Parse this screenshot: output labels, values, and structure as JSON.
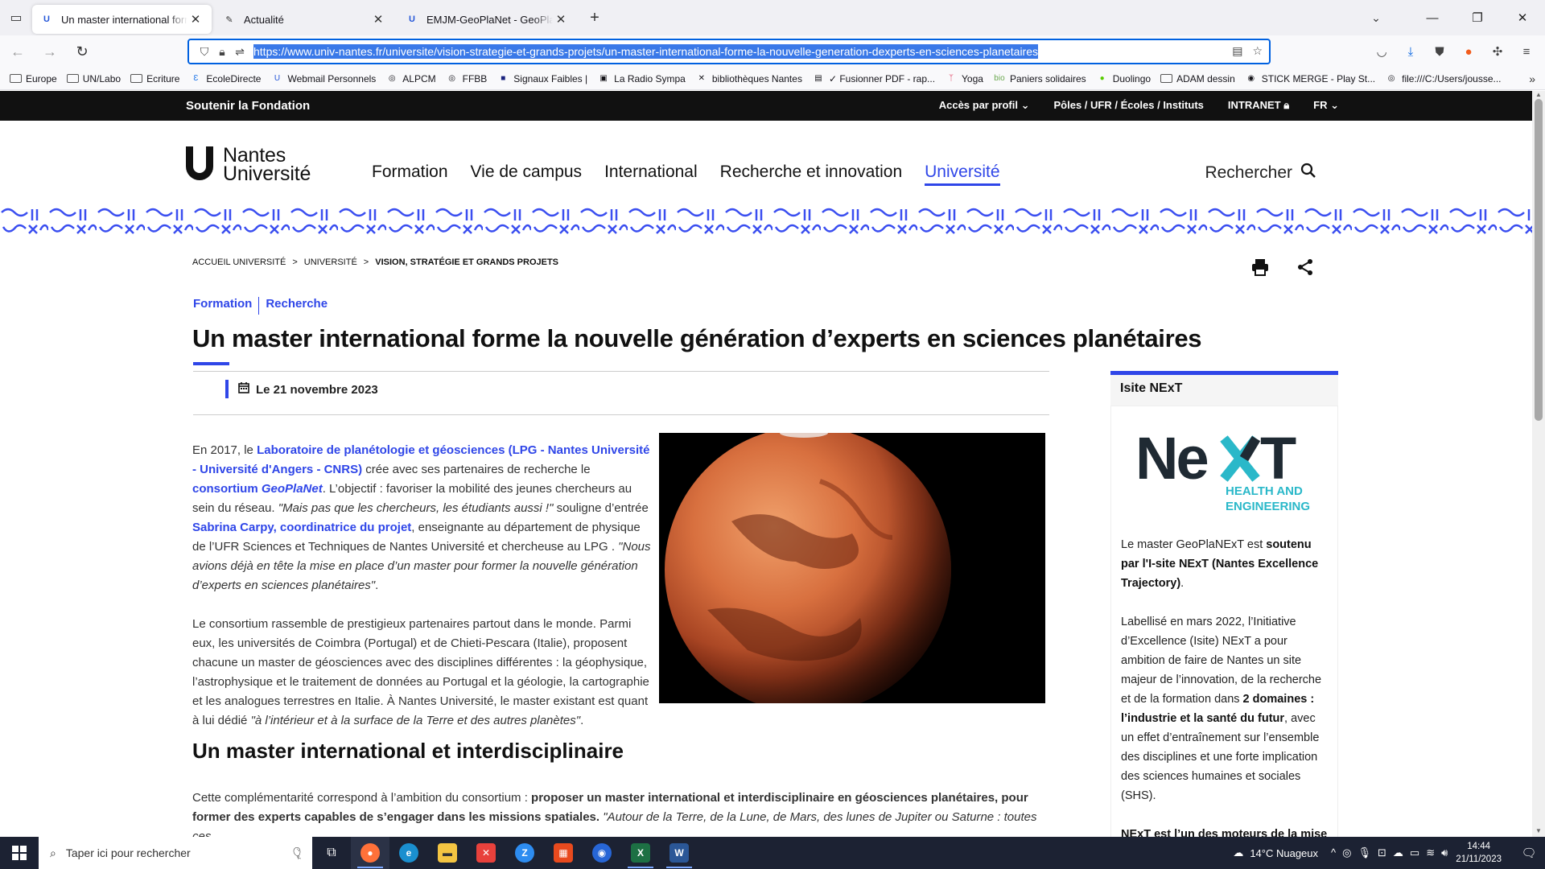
{
  "browser": {
    "tabs": [
      {
        "title": "Un master international forme la nouvelle génération",
        "favicon": "nantes-universite-icon",
        "active": true
      },
      {
        "title": "Actualité",
        "favicon": "edit-icon",
        "active": false
      },
      {
        "title": "EMJM-GeoPlaNet - GeoPlaNet",
        "favicon": "nantes-universite-icon",
        "active": false
      }
    ],
    "url": "https://www.univ-nantes.fr/universite/vision-strategie-et-grands-projets/un-master-international-forme-la-nouvelle-generation-dexperts-en-sciences-planetaires",
    "bookmarks": [
      {
        "label": "Europe",
        "icon": "folder-icon"
      },
      {
        "label": "UN/Labo",
        "icon": "folder-icon"
      },
      {
        "label": "Ecriture",
        "icon": "folder-icon"
      },
      {
        "label": "EcoleDirecte",
        "icon": "ecoledirecte-icon"
      },
      {
        "label": "Webmail Personnels",
        "icon": "nantes-universite-icon"
      },
      {
        "label": "ALPCM",
        "icon": "globe-icon"
      },
      {
        "label": "FFBB",
        "icon": "globe-icon"
      },
      {
        "label": "Signaux Faibles |",
        "icon": "signaux-icon"
      },
      {
        "label": "La Radio Sympa",
        "icon": "radio-icon"
      },
      {
        "label": "bibliothèques Nantes",
        "icon": "x-icon"
      },
      {
        "label": "✓ Fusionner PDF - rap...",
        "icon": "pdf-icon"
      },
      {
        "label": "Yoga",
        "icon": "yoga-icon"
      },
      {
        "label": "Paniers solidaires",
        "icon": "bio-icon"
      },
      {
        "label": "Duolingo",
        "icon": "duolingo-icon"
      },
      {
        "label": "ADAM dessin",
        "icon": "folder-icon"
      },
      {
        "label": "STICK MERGE - Play St...",
        "icon": "stick-icon"
      },
      {
        "label": "file:///C:/Users/jousse...",
        "icon": "globe-icon"
      }
    ]
  },
  "site": {
    "fondation": "Soutenir la Fondation",
    "top_links": [
      "Accès par profil",
      "Pôles / UFR / Écoles / Instituts",
      "INTRANET",
      "FR"
    ],
    "logo_line1": "Nantes",
    "logo_line2": "Université",
    "menu": [
      "Formation",
      "Vie de campus",
      "International",
      "Recherche et innovation",
      "Université"
    ],
    "menu_active": "Université",
    "search_label": "Rechercher"
  },
  "breadcrumb": [
    "ACCUEIL UNIVERSITÉ",
    "UNIVERSITÉ",
    "VISION, STRATÉGIE ET GRANDS PROJETS"
  ],
  "article": {
    "tags": [
      "Formation",
      "Recherche"
    ],
    "title": "Un master international forme la nouvelle génération d’experts en sciences planétaires",
    "date": "Le 21 novembre 2023",
    "h2": "Un master international et interdisciplinaire"
  },
  "sidebar": {
    "title": "Isite NExT",
    "logo_sub1": "HEALTH AND",
    "logo_sub2": "ENGINEERING"
  },
  "taskbar": {
    "search_placeholder": "Taper ici pour rechercher",
    "weather": "14°C  Nuageux",
    "time": "14:44",
    "date": "21/11/2023"
  },
  "colors": {
    "accent": "#2f46e8",
    "black_strip": "#111111",
    "next_dark": "#1f2a33",
    "next_teal": "#2ab8c9"
  }
}
